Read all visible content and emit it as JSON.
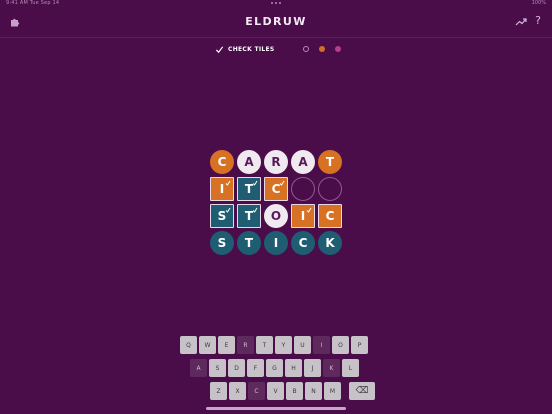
{
  "status": {
    "left": "9:41 AM  Tue Sep 14",
    "right": "100%"
  },
  "header": {
    "title": "ELDRUW"
  },
  "toolbar": {
    "check_label": "CHECK TILES"
  },
  "colors": {
    "background": "#4a0d49",
    "orange": "#d77224",
    "teal": "#1f5e72",
    "key": "#c7c2c7",
    "key_disabled": "#5e2a5d"
  },
  "board": {
    "rows": [
      {
        "tiles": [
          {
            "letter": "C",
            "style": "orange-round"
          },
          {
            "letter": "A",
            "style": "white-round"
          },
          {
            "letter": "R",
            "style": "white-round"
          },
          {
            "letter": "A",
            "style": "white-round"
          },
          {
            "letter": "T",
            "style": "orange-round"
          }
        ]
      },
      {
        "tiles": [
          {
            "letter": "I",
            "style": "orange-square-checked"
          },
          {
            "letter": "T",
            "style": "teal-square-checked"
          },
          {
            "letter": "C",
            "style": "orange-square-checked"
          },
          {
            "letter": "",
            "style": "empty-round"
          },
          {
            "letter": "",
            "style": "empty-round"
          }
        ]
      },
      {
        "tiles": [
          {
            "letter": "S",
            "style": "teal-square-checked"
          },
          {
            "letter": "T",
            "style": "teal-square-checked"
          },
          {
            "letter": "O",
            "style": "white-round"
          },
          {
            "letter": "I",
            "style": "orange-square-checked"
          },
          {
            "letter": "C",
            "style": "orange-square"
          }
        ]
      },
      {
        "tiles": [
          {
            "letter": "S",
            "style": "teal-round"
          },
          {
            "letter": "T",
            "style": "teal-round"
          },
          {
            "letter": "I",
            "style": "teal-round"
          },
          {
            "letter": "C",
            "style": "teal-round"
          },
          {
            "letter": "K",
            "style": "teal-round"
          }
        ]
      }
    ]
  },
  "keyboard": {
    "rows": [
      {
        "keys": [
          {
            "label": "Q",
            "state": "normal"
          },
          {
            "label": "W",
            "state": "normal"
          },
          {
            "label": "E",
            "state": "normal"
          },
          {
            "label": "R",
            "state": "disabled"
          },
          {
            "label": "T",
            "state": "normal"
          },
          {
            "label": "Y",
            "state": "normal"
          },
          {
            "label": "U",
            "state": "normal"
          },
          {
            "label": "I",
            "state": "disabled"
          },
          {
            "label": "O",
            "state": "normal"
          },
          {
            "label": "P",
            "state": "normal"
          }
        ]
      },
      {
        "keys": [
          {
            "label": "A",
            "state": "disabled"
          },
          {
            "label": "S",
            "state": "normal"
          },
          {
            "label": "D",
            "state": "normal"
          },
          {
            "label": "F",
            "state": "normal"
          },
          {
            "label": "G",
            "state": "normal"
          },
          {
            "label": "H",
            "state": "normal"
          },
          {
            "label": "J",
            "state": "normal"
          },
          {
            "label": "K",
            "state": "disabled"
          },
          {
            "label": "L",
            "state": "normal"
          }
        ]
      },
      {
        "keys": [
          {
            "label": "Z",
            "state": "normal"
          },
          {
            "label": "X",
            "state": "normal"
          },
          {
            "label": "C",
            "state": "disabled"
          },
          {
            "label": "V",
            "state": "normal"
          },
          {
            "label": "B",
            "state": "normal"
          },
          {
            "label": "N",
            "state": "normal"
          },
          {
            "label": "M",
            "state": "normal"
          },
          {
            "label": "⌫",
            "state": "backspace"
          }
        ]
      }
    ]
  }
}
